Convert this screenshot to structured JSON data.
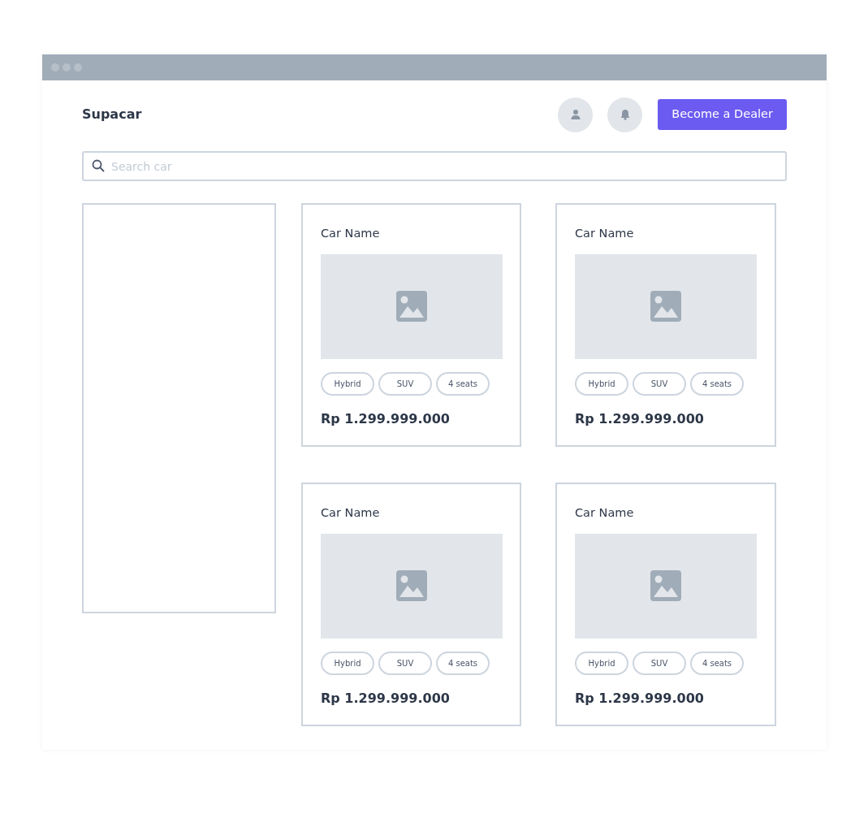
{
  "brand": "Supacar",
  "header_buttons": [
    {
      "kind": "user"
    },
    {
      "kind": "bell"
    }
  ],
  "cta": "Become a Dealer",
  "search": {
    "placeholder": "Search car"
  },
  "cars": [
    {
      "name": "Car Name",
      "tags": [
        "Hybrid",
        "SUV",
        "4 seats"
      ],
      "price": "Rp 1.299.999.000",
      "photo": {
        "kind": "picture"
      }
    },
    {
      "name": "Car Name",
      "tags": [
        "Hybrid",
        "SUV",
        "4 seats"
      ],
      "price": "Rp 1.299.999.000",
      "photo": {
        "kind": "picture"
      }
    },
    {
      "name": "Car Name",
      "tags": [
        "Hybrid",
        "SUV",
        "4 seats"
      ],
      "price": "Rp 1.299.999.000",
      "photo": {
        "kind": "picture"
      }
    },
    {
      "name": "Car Name",
      "tags": [
        "Hybrid",
        "SUV",
        "4 seats"
      ],
      "price": "Rp 1.299.999.000",
      "photo": {
        "kind": "picture"
      }
    }
  ]
}
